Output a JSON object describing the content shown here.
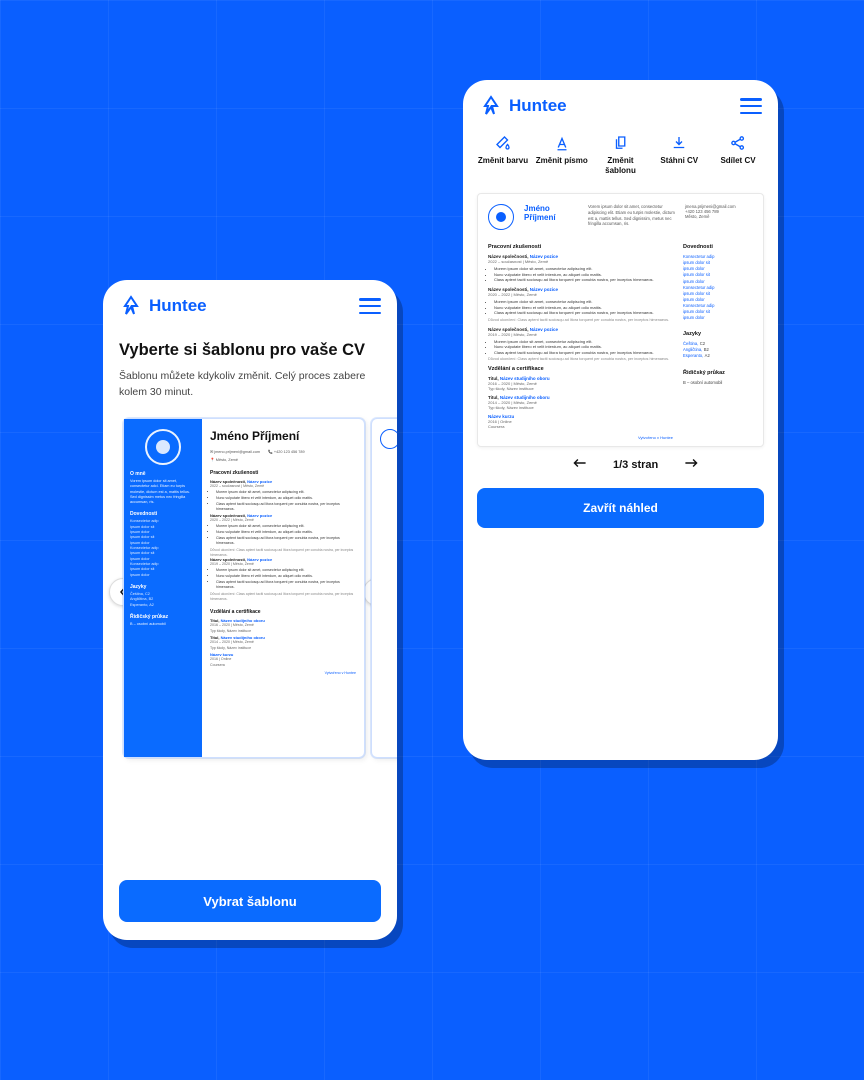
{
  "brand": "Huntee",
  "left": {
    "title": "Vyberte si šablonu pro vaše CV",
    "subtitle": "Šablonu můžete kdykoliv změnit. Celý proces zabere kolem 30 minut.",
    "select_button": "Vybrat šablonu",
    "cv": {
      "name": "Jméno Příjmení",
      "email": "jmeno.prijmeni@gmail.com",
      "phone": "+420 123 456 789",
      "location": "Město, Země",
      "about_h": "O mně",
      "about": "Vorem ipsum dolor sit amet, consectetur adci. Etiam eu turpis molestie, dictum est a, mattis tellus. Sed dignissim metus nec fringilla accumsan, ris.",
      "skills_h": "Dovednosti",
      "skills": [
        "Konsectetur adip",
        "ipsum dolor sit",
        "ipsum dolor",
        "ipsum dolor sit",
        "ipsum dolor",
        "Konsectetur adip",
        "ipsum dolor sit",
        "ipsum dolor",
        "Konsectetur adip",
        "ipsum dolor sit",
        "ipsum dolor"
      ],
      "lang_h": "Jazyky",
      "langs": [
        "Čeština, C2",
        "Angličtina, B2",
        "Esperanto, A2"
      ],
      "licence_h": "Řidičský průkaz",
      "licence": "B – osobní automobil",
      "work_h": "Pracovní zkušenosti",
      "jobs": [
        {
          "co": "Název společnosti,",
          "pos": "Název pozice",
          "date": "2022 – současnost | Město, Země"
        },
        {
          "co": "Název společnosti,",
          "pos": "Název pozice",
          "date": "2020 – 2022 | Město, Země"
        },
        {
          "co": "Název společnosti,",
          "pos": "Název pozice",
          "date": "2019 – 2020 | Město, Země"
        }
      ],
      "bullets": [
        "Morem ipsum dolor sit amet, consectetur adipiscing elit.",
        "Nunc vulputate libero et velit interdum, ac aliquet odio mattis.",
        "Class aptent taciti sociosqu ad litora torquent per conubia nostra, per inceptos himenaeos."
      ],
      "note": "Důvod ukončení: Class aptent taciti sociosqu ad litora torquent per conubia nostra, per inceptos himenaeos.",
      "edu_h": "Vzdělání a certifikace",
      "edu": [
        {
          "title": "Titul,",
          "field": "Název studijního oboru",
          "date": "2016 – 2020 | Město, Země",
          "inst": "Typ školy, Název instituce"
        },
        {
          "title": "Titul,",
          "field": "Název studijního oboru",
          "date": "2014 – 2020 | Město, Země",
          "inst": "Typ školy, Název instituce"
        }
      ],
      "course": {
        "name": "Název kurzu",
        "date": "2016 | Online",
        "provider": "Coursera"
      },
      "sig": "Vytvořeno v Huntee"
    }
  },
  "right": {
    "toolbar": {
      "color": "Změnit barvu",
      "font": "Změnit písmo",
      "template": "Změnit šablonu",
      "download": "Stáhni CV",
      "share": "Sdílet CV"
    },
    "close_button": "Zavřít náhled",
    "pager": "1/3 stran",
    "cv": {
      "name1": "Jméno",
      "name2": "Příjmení",
      "lorem": "Vorem ipsum dolor sit amet, consectetur adipiscing elit. Etiam eu turpis molestie, dictum est a, mattis tellus. Sed dignissim, metus nec fringilla accumsan, ris.",
      "email": "jmena.prijmeni@gmail.com",
      "phone": "+420 123 456 789",
      "location": "Město, Země",
      "work_h": "Pracovní zkušenosti",
      "jobs": [
        {
          "co": "Název společnosti,",
          "pos": "Název pozice",
          "date": "2022 – současnost | Město, Země",
          "bullets": true,
          "note": false
        },
        {
          "co": "Název společnosti,",
          "pos": "Název pozice",
          "date": "2020 – 2022 | Město, Země",
          "bullets": true,
          "note": true
        },
        {
          "co": "Název společnosti,",
          "pos": "Název pozice",
          "date": "2019 – 2020 | Město, Země",
          "bullets": true,
          "note": true
        }
      ],
      "bullets": [
        "Morem ipsum dolor sit amet, consectetur adipiscing elit.",
        "Nunc vulputate libero et velit interdum, ac aliquet odio mattis.",
        "Class aptent taciti sociosqu ad litora torquent per conubia nostra, per inceptos himenaeos."
      ],
      "note": "Důvod ukončení: Class aptent taciti sociosqu ad litora torquent per conubia nostra, per inceptos himenaeos.",
      "edu_h": "Vzdělání a certifikace",
      "edu": [
        {
          "title": "Titul,",
          "field": "Název studijního oboru",
          "date": "2016 – 2020 | Město, Země",
          "inst": "Typ školy, Název instituce"
        },
        {
          "title": "Titul,",
          "field": "Název studijního oboru",
          "date": "2014 – 2020 | Město, Země",
          "inst": "Typ školy, Název instituce"
        }
      ],
      "course": {
        "name": "Název kurzu",
        "date": "2016 | Online",
        "provider": "Coursera"
      },
      "skills_h": "Dovednosti",
      "skills": [
        "Konsectetur adip",
        "ipsum dolor sit",
        "ipsum dolor",
        "ipsum dolor sit",
        "ipsum dolor",
        "Konsectetur adip",
        "ipsum dolor sit",
        "ipsum dolor",
        "Konsectetur adip",
        "ipsum dolor sit",
        "ipsum dolor"
      ],
      "lang_h": "Jazyky",
      "langs": [
        [
          "Čeština,",
          "C2"
        ],
        [
          "Angličtina,",
          "B2"
        ],
        [
          "Esperanto,",
          "A2"
        ]
      ],
      "licence_h": "Řidičský průkaz",
      "licence": "B – osobní automobil",
      "sig": "Vytvořeno v Huntee"
    }
  }
}
